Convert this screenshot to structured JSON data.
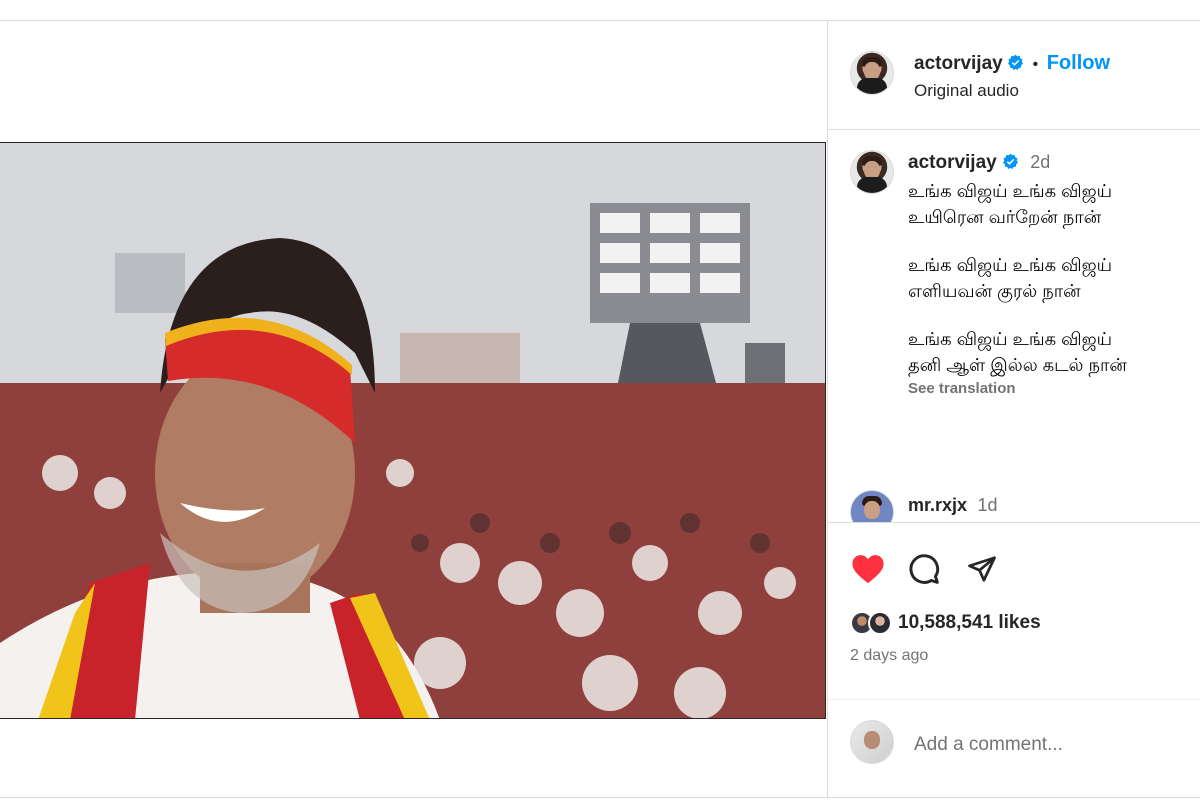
{
  "post": {
    "author": "actorvijay",
    "follow_label": "Follow",
    "separator": "•",
    "audio_label": "Original audio"
  },
  "caption": {
    "author": "actorvijay",
    "time": "2d",
    "lines": [
      "உங்க விஜய் உங்க விஜய்",
      "உயிரென வர்றேன் நான்",
      "உங்க விஜய் உங்க விஜய்",
      "எளியவன் குரல் நான்",
      "உங்க விஜய் உங்க விஜய்",
      "தனி ஆள் இல்ல கடல் நான்"
    ],
    "see_translation": "See translation"
  },
  "comment_preview": {
    "author": "mr.rxjx",
    "time": "1d"
  },
  "engagement": {
    "likes": "10,588,541 likes",
    "posted": "2 days ago",
    "add_comment_placeholder": "Add a comment..."
  },
  "icons": {
    "like": "heart-filled-icon",
    "comment": "comment-bubble-icon",
    "share": "share-paper-plane-icon",
    "verified": "verified-badge-icon",
    "audio": "speaker-icon"
  },
  "colors": {
    "like_red": "#ff3040",
    "follow_blue": "#0095f6",
    "verified_blue": "#0095f6",
    "muted": "#737373"
  }
}
